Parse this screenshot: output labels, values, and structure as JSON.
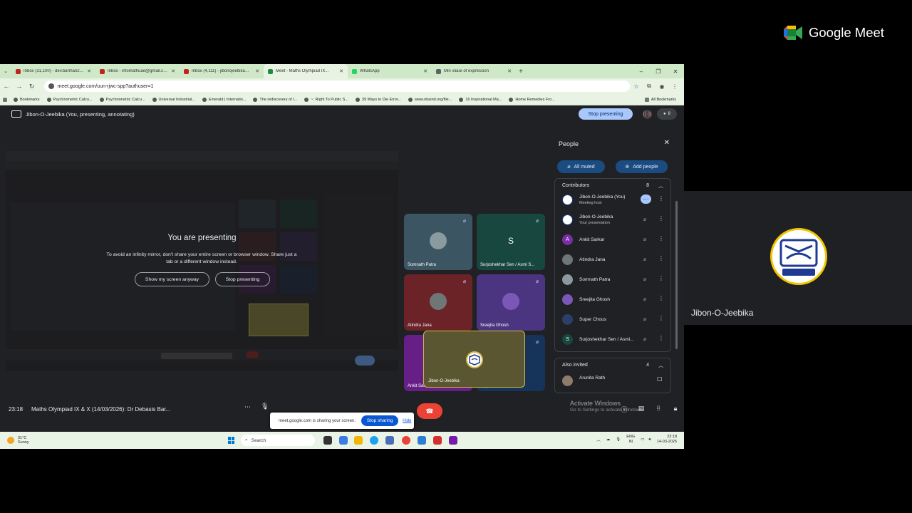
{
  "browser": {
    "tabs": [
      {
        "label": "Inbox (31,100) - dev.barman20...",
        "color": "#c5221f"
      },
      {
        "label": "Inbox - infomathuae@gmail.co...",
        "color": "#c5221f"
      },
      {
        "label": "Inbox (4,111) - jibonojeebika@...",
        "color": "#c5221f"
      },
      {
        "label": "Meet - Maths Olympiad IX...",
        "color": "#1e8e3e",
        "active": true
      },
      {
        "label": "WhatsApp",
        "color": "#25d366"
      },
      {
        "label": "Min value of expression",
        "color": "#5f6368"
      }
    ],
    "url": "meet.google.com/uun-rjwc-spp?authuser=1",
    "bookmarks": [
      "Bookmarks",
      "Psychrometric Calcu...",
      "Psychrometric Calcu...",
      "Universal Industrial...",
      "Emerald | Internatio...",
      "The rediscovery of I...",
      "~: Right To Public S...",
      "39 Ways to Die Error...",
      "www.nbaind.org/file...",
      "16 Inspirational Ma...",
      "Home Remedies Fro..."
    ],
    "all_bookmarks": "All Bookmarks"
  },
  "meet": {
    "presenting_label": "Jibon-O-Jeebika (You, presenting, annotating)",
    "stop_presenting_top": "Stop presenting",
    "participant_count": "8",
    "share_notice": {
      "title": "You are presenting",
      "body": "To avoid an infinity mirror, don't share your entire screen or browser window. Share just a tab or a different window instead.",
      "show_anyway": "Show my screen anyway",
      "stop": "Stop presenting"
    },
    "tiles": [
      {
        "name": "Somnath Patra",
        "bg": "#3b5563",
        "avatar": "",
        "avbg": "#8a9a9e"
      },
      {
        "name": "Surjoshekhar Sen / Asmi S...",
        "bg": "#17473e",
        "avatar": "S",
        "avbg": "transparent"
      },
      {
        "name": "Atindra Jana",
        "bg": "#6b2328",
        "avatar": "",
        "avbg": "#6e7775"
      },
      {
        "name": "Sreejita Ghosh",
        "bg": "#4b3580",
        "avatar": "",
        "avbg": "#7b58b8"
      },
      {
        "name": "Ankit Sarkar",
        "bg": "#651f87",
        "avatar": "A",
        "avbg": "#7b2fa6"
      },
      {
        "name": "Super Chous",
        "bg": "#163459",
        "avatar": "",
        "avbg": "#2b3f6a"
      }
    ],
    "self_tile_name": "Jibon-O-Jeebika",
    "clock": "23:18",
    "meeting_title": "Maths Olympiad IX & X (14/03/2026): Dr Debasis Bar...",
    "sharing_bar": {
      "text": "meet.google.com is sharing your screen.",
      "stop": "Stop sharing",
      "hide": "Hide"
    },
    "activate": {
      "title": "Activate Windows",
      "sub": "Go to Settings to activate Windows."
    }
  },
  "people": {
    "title": "People",
    "all_muted": "All muted",
    "add_people": "Add people",
    "contributors_label": "Contributors",
    "contributors_count": "8",
    "list": [
      {
        "name": "Jibon-O-Jeebika (You)",
        "sub": "Meeting host",
        "initial": "",
        "bg": "#ffffff"
      },
      {
        "name": "Jibon-O-Jeebika",
        "sub": "Your presentation",
        "initial": "",
        "bg": "#ffffff"
      },
      {
        "name": "Ankit Sarkar",
        "sub": "",
        "initial": "A",
        "bg": "#7b2fa6"
      },
      {
        "name": "Atindra Jana",
        "sub": "",
        "initial": "",
        "bg": "#6e7775"
      },
      {
        "name": "Somnath Patra",
        "sub": "",
        "initial": "",
        "bg": "#8a9a9e"
      },
      {
        "name": "Sreejita Ghosh",
        "sub": "",
        "initial": "",
        "bg": "#7b58b8"
      },
      {
        "name": "Super Chous",
        "sub": "",
        "initial": "",
        "bg": "#2b3f6a"
      },
      {
        "name": "Surjoshekhar Sen / Asmi...",
        "sub": "",
        "initial": "S",
        "bg": "#17473e"
      }
    ],
    "also_invited_label": "Also invited",
    "also_invited_count": "4",
    "invited": [
      {
        "name": "Arunita Rath"
      }
    ]
  },
  "taskbar": {
    "weather_temp": "31°C",
    "weather_cond": "Sunny",
    "search": "Search",
    "lang1": "ENG",
    "lang2": "IN",
    "time": "23:18",
    "date": "14-03-2026"
  },
  "stage": {
    "brand": "Google Meet",
    "self_label": "Jibon-O-Jeebika"
  }
}
